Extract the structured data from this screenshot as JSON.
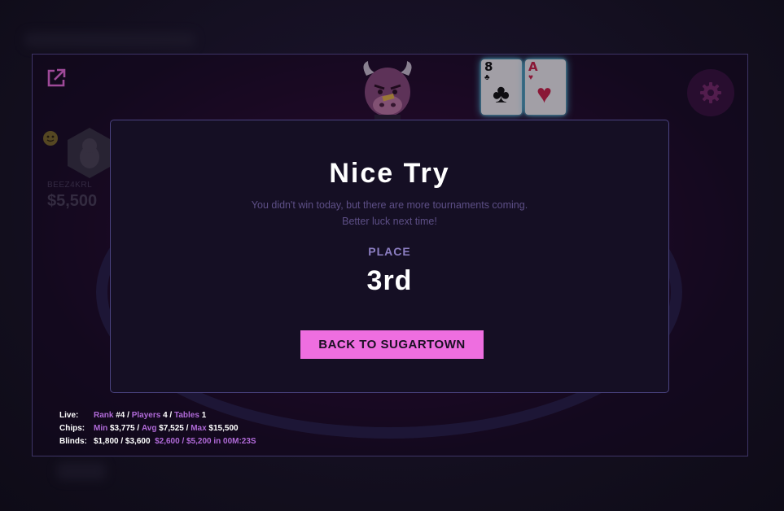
{
  "modal": {
    "title": "Nice Try",
    "message_line1": "You didn't win today, but there are more tournaments coming.",
    "message_line2": "Better luck next time!",
    "place_label": "PLACE",
    "place_value": "3rd",
    "button_label": "BACK TO SUGARTOWN"
  },
  "seat": {
    "name": "BEEZ4KRL",
    "stack": "$5,500"
  },
  "cards": [
    {
      "rank": "8",
      "suit": "clubs",
      "symbol": "♣",
      "color": "#111111"
    },
    {
      "rank": "A",
      "suit": "hearts",
      "symbol": "♥",
      "color": "#d0214a"
    }
  ],
  "stats": {
    "live": {
      "label": "Live:",
      "rank_label": "Rank",
      "rank_value": "#4",
      "players_label": "Players",
      "players_value": "4",
      "tables_label": "Tables",
      "tables_value": "1"
    },
    "chips": {
      "label": "Chips:",
      "min_label": "Min",
      "min_value": "$3,775",
      "avg_label": "Avg",
      "avg_value": "$7,525",
      "max_label": "Max",
      "max_value": "$15,500"
    },
    "blinds": {
      "label": "Blinds:",
      "current": "$1,800 / $3,600",
      "next": "$2,600 / $5,200 in 00M:23S"
    }
  },
  "icons": {
    "popout": "external-link-icon",
    "settings": "gear-icon"
  },
  "colors": {
    "accent_pink": "#ee6ee0",
    "accent_purple": "#b06ad8",
    "modal_bg": "#150f24",
    "modal_border": "#4a4380"
  }
}
